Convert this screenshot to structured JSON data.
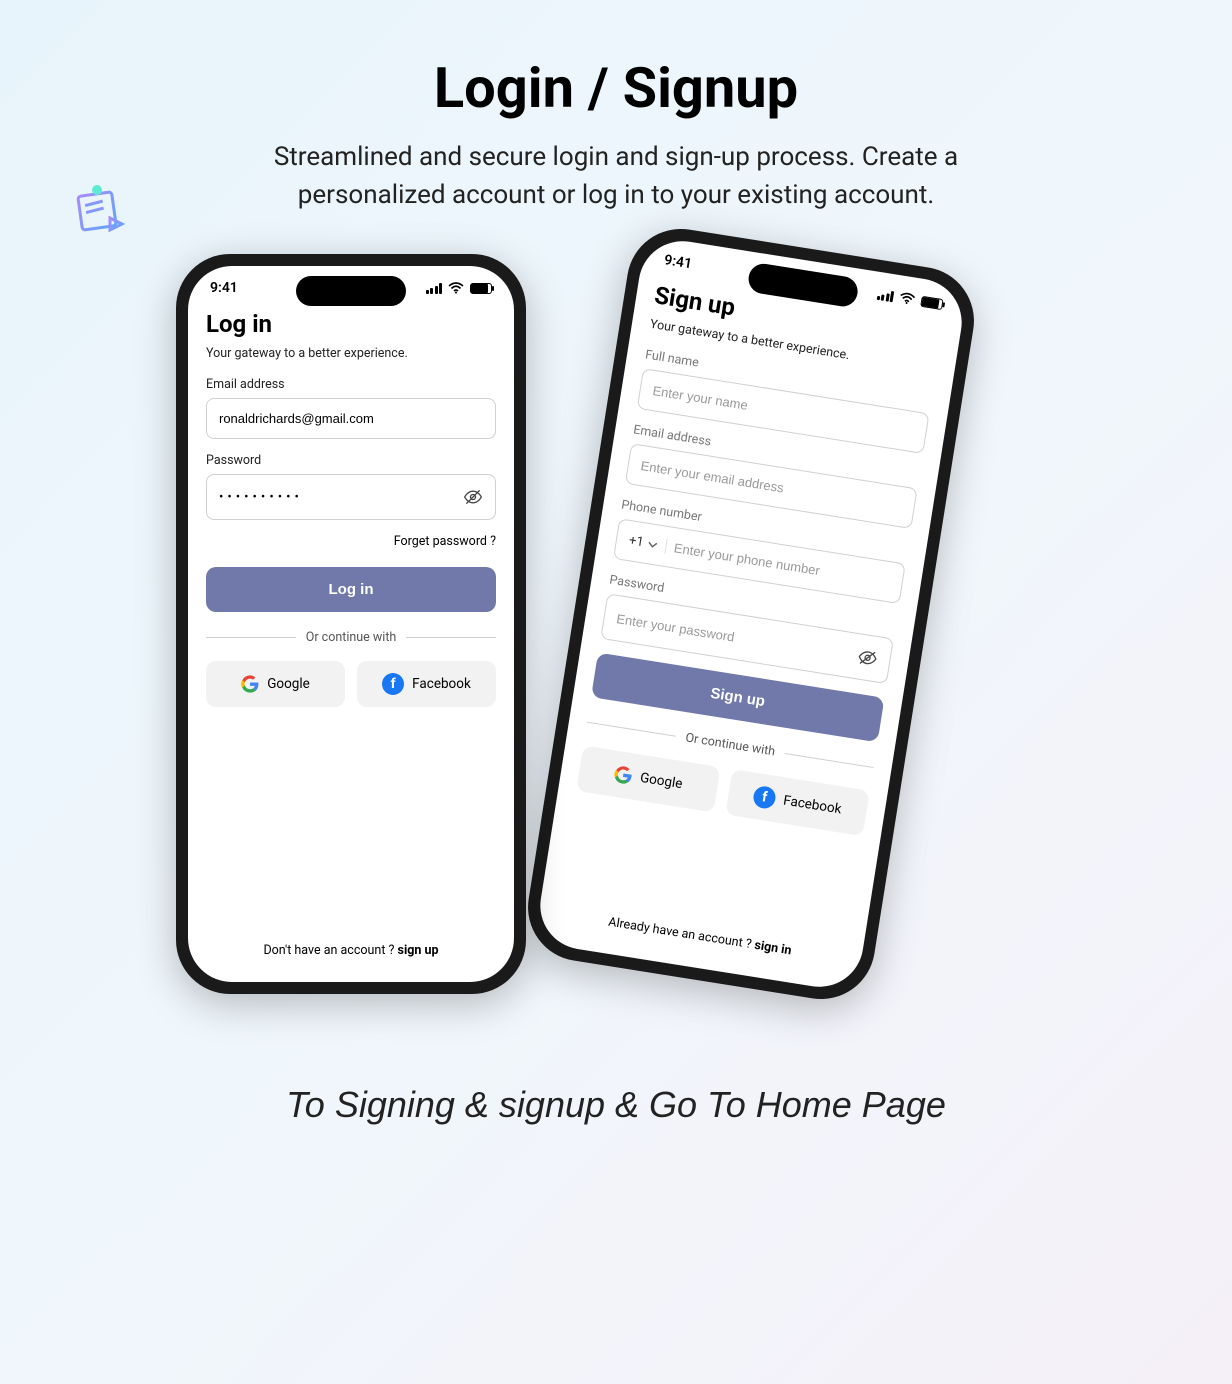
{
  "header": {
    "title": "Login / Signup",
    "subtitle": "Streamlined and secure login and sign-up process. Create a personalized account or log in to your existing account."
  },
  "status": {
    "time": "9:41"
  },
  "login": {
    "title": "Log in",
    "subtitle": "Your gateway to a better experience.",
    "email_label": "Email address",
    "email_value": "ronaldrichards@gmail.com",
    "password_label": "Password",
    "password_value": "••••••••••",
    "forgot": "Forget password ?",
    "button": "Log in",
    "divider": "Or continue with",
    "google": "Google",
    "facebook": "Facebook",
    "footer_pre": "Don't have an account ? ",
    "footer_link": "sign up"
  },
  "signup": {
    "title": "Sign up",
    "subtitle": "Your gateway to a better experience.",
    "fullname_label": "Full name",
    "fullname_ph": "Enter your name",
    "email_label": "Email address",
    "email_ph": "Enter your email address",
    "phone_label": "Phone number",
    "phone_code": "+1",
    "phone_ph": "Enter your phone number",
    "password_label": "Password",
    "password_ph": "Enter your password",
    "button": "Sign up",
    "divider": "Or continue with",
    "google": "Google",
    "facebook": "Facebook",
    "footer_pre": "Already have an account ? ",
    "footer_link": "sign in"
  },
  "bottom_caption": "To Signing & signup & Go To Home Page"
}
